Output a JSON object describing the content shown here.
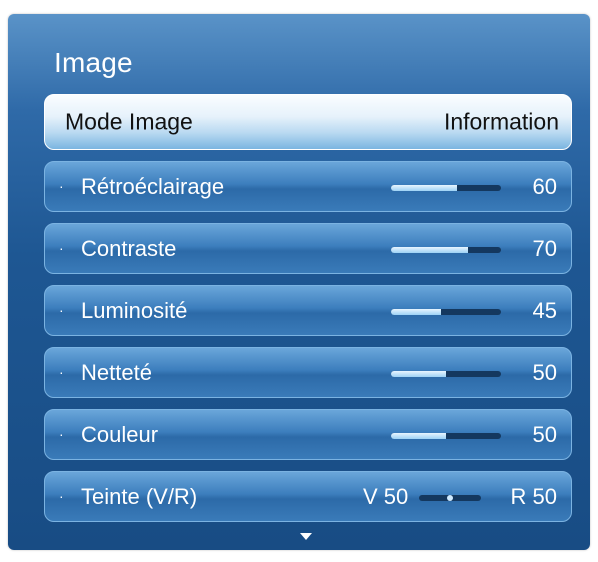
{
  "menu": {
    "title": "Image",
    "selected": {
      "label": "Mode Image",
      "value": "Information"
    },
    "items": [
      {
        "label": "Rétroéclairage",
        "value": "60",
        "level": 0.6
      },
      {
        "label": "Contraste",
        "value": "70",
        "level": 0.7
      },
      {
        "label": "Luminosité",
        "value": "45",
        "level": 0.45
      },
      {
        "label": "Netteté",
        "value": "50",
        "level": 0.5
      },
      {
        "label": "Couleur",
        "value": "50",
        "level": 0.5
      }
    ],
    "tint": {
      "label": "Teinte (V/R)",
      "left_value": "V 50",
      "right_value": "R 50",
      "level": 0.5
    },
    "bullet_glyph": "·",
    "scroll_icon": "arrow-down-icon"
  },
  "colors": {
    "panel": "#1e5793",
    "row": "#3c7ebd",
    "selected_row": "#e6f2fb",
    "slider_track": "#14385f",
    "slider_fill": "#9dd2f5"
  }
}
